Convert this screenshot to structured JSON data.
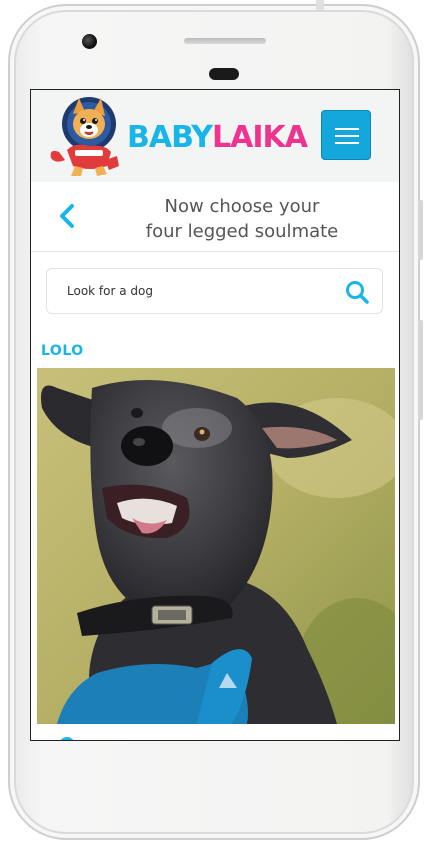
{
  "header": {
    "brand_part1": "BABY",
    "brand_part2": "LAIKA"
  },
  "title_bar": {
    "title": "Now choose your\nfour legged soulmate"
  },
  "search": {
    "placeholder": "Look for a dog"
  },
  "dogs": [
    {
      "name": "LOLO"
    }
  ],
  "colors": {
    "brand_blue": "#18b6e8",
    "brand_pink": "#f0338f",
    "menu_button": "#14a7dc"
  },
  "icons": {
    "menu": "hamburger-menu-icon",
    "back": "chevron-left-icon",
    "search": "search-icon"
  }
}
